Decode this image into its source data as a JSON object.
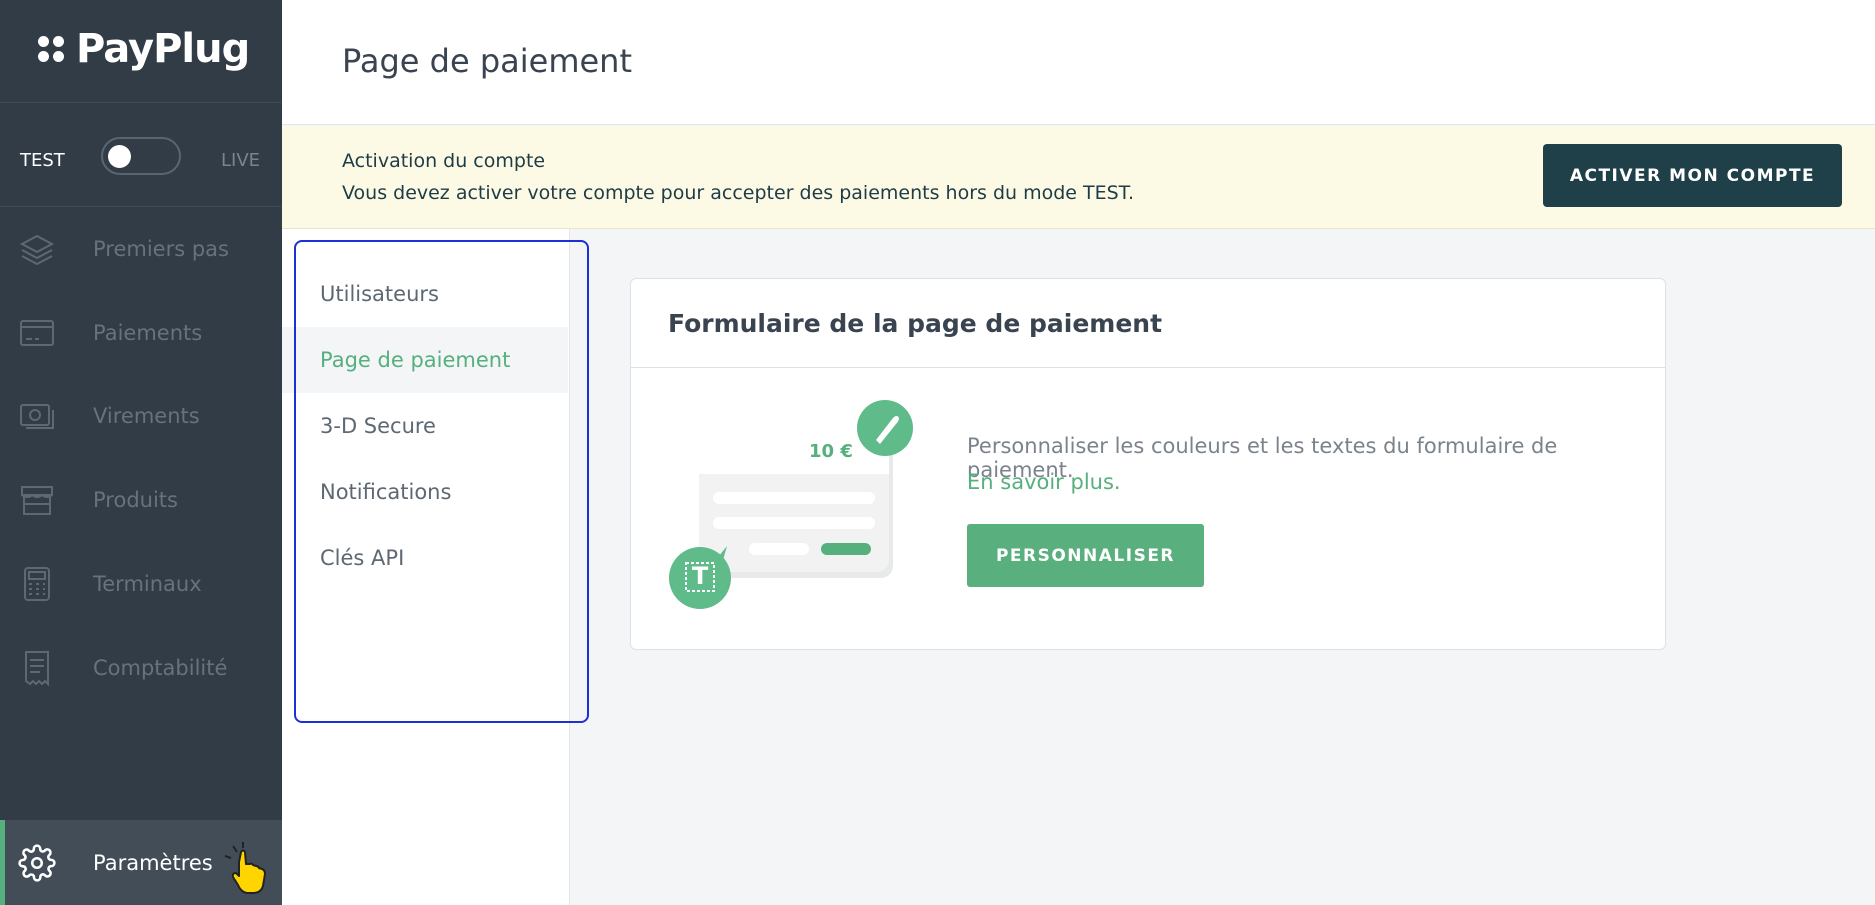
{
  "brand": {
    "name": "PayPlug"
  },
  "mode": {
    "test_label": "TEST",
    "live_label": "LIVE"
  },
  "sidebar": {
    "items": [
      {
        "label": "Premiers pas",
        "icon": "layers-icon"
      },
      {
        "label": "Paiements",
        "icon": "credit-card-icon"
      },
      {
        "label": "Virements",
        "icon": "money-transfer-icon"
      },
      {
        "label": "Produits",
        "icon": "store-icon"
      },
      {
        "label": "Terminaux",
        "icon": "terminal-icon"
      },
      {
        "label": "Comptabilité",
        "icon": "receipt-icon"
      }
    ],
    "settings": {
      "label": "Paramètres",
      "icon": "gear-icon"
    }
  },
  "header": {
    "title": "Page de paiement"
  },
  "banner": {
    "title": "Activation du compte",
    "text": "Vous devez activer votre compte pour accepter des paiements hors du mode TEST.",
    "button": "ACTIVER MON COMPTE"
  },
  "subnav": {
    "items": [
      {
        "label": "Utilisateurs"
      },
      {
        "label": "Page de paiement",
        "active": true
      },
      {
        "label": "3-D Secure"
      },
      {
        "label": "Notifications"
      },
      {
        "label": "Clés API"
      }
    ]
  },
  "card": {
    "title": "Formulaire de la page de paiement",
    "description": "Personnaliser les couleurs et les textes du formulaire de paiement.",
    "link": "En savoir plus.",
    "button": "PERSONNALISER",
    "illustration_amount": "10 €"
  },
  "colors": {
    "accent": "#56b07d",
    "sidebar": "#323c46",
    "dark_button": "#1f4048",
    "banner": "#fcf9e5"
  }
}
